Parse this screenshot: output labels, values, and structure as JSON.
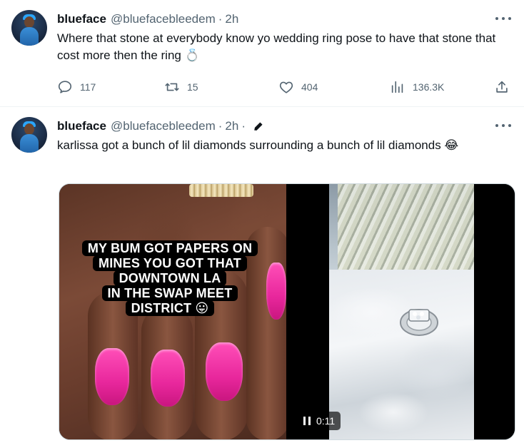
{
  "tweets": [
    {
      "name": "blueface",
      "handle": "@bluefacebleedem",
      "separator": "·",
      "time": "2h",
      "text": "Where that stone at everybody know yo wedding ring pose to have that stone that cost more then the ring 💍",
      "actions": {
        "replies": "117",
        "retweets": "15",
        "likes": "404",
        "views": "136.3K"
      }
    },
    {
      "name": "blueface",
      "handle": "@bluefacebleedem",
      "separator": "·",
      "time": "2h",
      "separator2": "·",
      "text": "karlissa got a bunch of lil diamonds surrounding a bunch of lil diamonds 😂",
      "media": {
        "caption_lines": [
          "MY BUM GOT PAPERS ON",
          "MINES YOU GOT THAT",
          "DOWNTOWN LA",
          "IN THE SWAP MEET",
          "DISTRICT 😛"
        ],
        "video_time": "0:11"
      }
    }
  ],
  "icons": {
    "reply": "reply-icon",
    "retweet": "retweet-icon",
    "like": "heart-icon",
    "views": "views-chart-icon",
    "share": "share-icon",
    "edit": "edit-pencil-icon",
    "more": "more-dots-icon",
    "pause": "pause-icon"
  },
  "colors": {
    "text_primary": "#0f1419",
    "text_secondary": "#536471",
    "divider": "#eff3f4",
    "nail_pink": "#ff4fb8"
  }
}
